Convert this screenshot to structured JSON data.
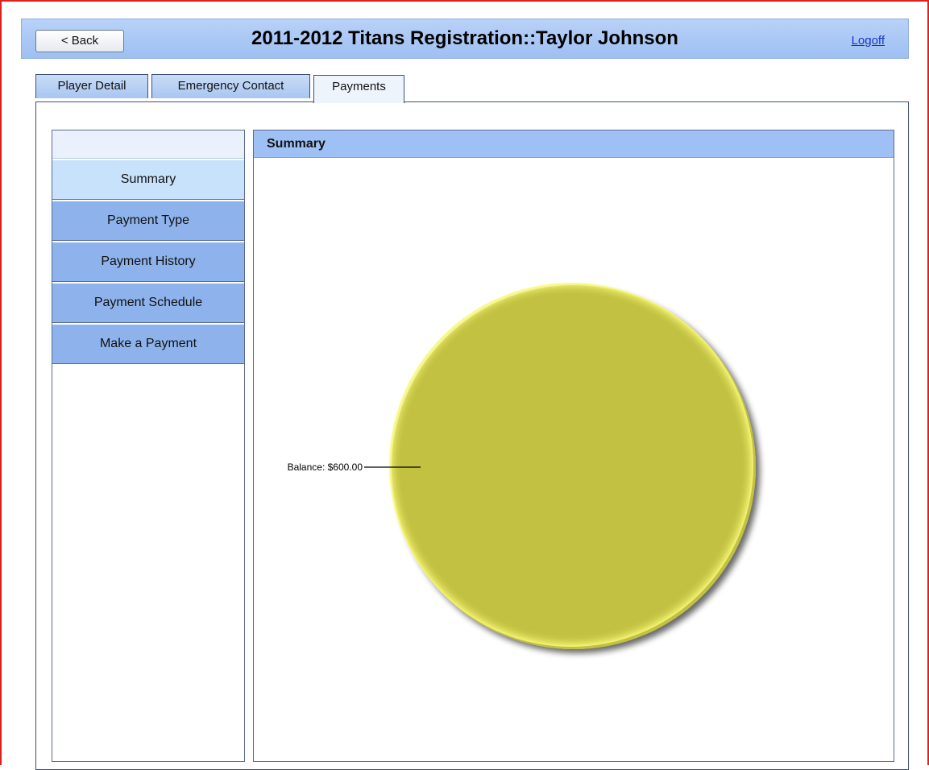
{
  "header": {
    "back_label": "< Back",
    "title": "2011-2012 Titans Registration::Taylor Johnson",
    "logoff_label": "Logoff"
  },
  "tabs": [
    {
      "label": "Player Detail",
      "active": false
    },
    {
      "label": "Emergency Contact",
      "active": false
    },
    {
      "label": "Payments",
      "active": true
    }
  ],
  "sidebar": {
    "items": [
      {
        "label": "Summary",
        "active": true
      },
      {
        "label": "Payment Type",
        "active": false
      },
      {
        "label": "Payment History",
        "active": false
      },
      {
        "label": "Payment Schedule",
        "active": false
      },
      {
        "label": "Make a Payment",
        "active": false
      }
    ]
  },
  "content": {
    "section_title": "Summary"
  },
  "colors": {
    "pie_fill": "#c2c142",
    "pie_highlight": "#fdfd7a",
    "header_blue": "#9fc0f5",
    "nav_blue": "#8eb3ec",
    "nav_active": "#c9e2fb",
    "frame_red": "#e0201c"
  },
  "chart_data": {
    "type": "pie",
    "categories": [
      "Balance"
    ],
    "values": [
      600.0
    ],
    "slice_labels": [
      "Balance: $600.00"
    ],
    "title": ""
  }
}
